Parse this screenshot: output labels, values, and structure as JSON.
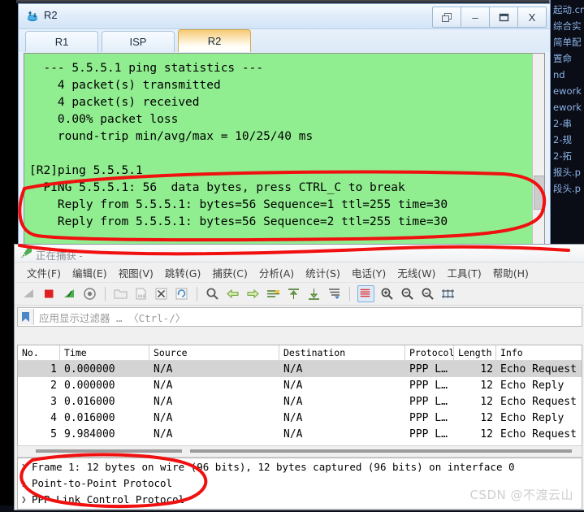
{
  "router_window": {
    "title": "R2",
    "icon": "router-icon",
    "window_buttons": [
      {
        "name": "restore-button",
        "label": "❐"
      },
      {
        "name": "minimize-button",
        "label": "–"
      },
      {
        "name": "maximize-button",
        "label": "▭"
      },
      {
        "name": "close-button",
        "label": "X"
      }
    ],
    "tabs": [
      {
        "label": "R1",
        "active": false
      },
      {
        "label": "ISP",
        "active": false
      },
      {
        "label": "R2",
        "active": true
      }
    ],
    "terminal_bg": "#90ee90",
    "terminal_text": "  --- 5.5.5.1 ping statistics ---\n    4 packet(s) transmitted\n    4 packet(s) received\n    0.00% packet loss\n    round-trip min/avg/max = 10/25/40 ms\n\n[R2]ping 5.5.5.1\n  PING 5.5.5.1: 56  data bytes, press CTRL_C to break\n    Reply from 5.5.5.1: bytes=56 Sequence=1 ttl=255 time=30\n    Reply from 5.5.5.1: bytes=56 Sequence=2 ttl=255 time=30"
  },
  "wireshark": {
    "title": "正在捕获 -",
    "icon": "wireshark-icon",
    "menus": [
      "文件(F)",
      "编辑(E)",
      "视图(V)",
      "跳转(G)",
      "捕获(C)",
      "分析(A)",
      "统计(S)",
      "电话(Y)",
      "无线(W)",
      "工具(T)",
      "帮助(H)"
    ],
    "toolbar_icons": [
      "start-capture-icon",
      "stop-capture-icon",
      "restart-capture-icon",
      "capture-options-icon",
      "open-file-icon",
      "save-file-icon",
      "close-file-icon",
      "reload-file-icon",
      "find-packet-icon",
      "go-back-icon",
      "go-forward-icon",
      "go-to-packet-icon",
      "go-to-first-icon",
      "go-to-last-icon",
      "auto-scroll-icon",
      "colorize-icon",
      "zoom-in-icon",
      "zoom-out-icon",
      "zoom-reset-icon",
      "resize-columns-icon"
    ],
    "filter": {
      "bookmark_icon": "bookmark-icon",
      "placeholder": "应用显示过滤器 … 〈Ctrl-/〉",
      "value": ""
    },
    "packet_list": {
      "columns": [
        "No.",
        "Time",
        "Source",
        "Destination",
        "Protocol",
        "Length",
        "Info"
      ],
      "rows": [
        {
          "no": "1",
          "time": "0.000000",
          "source": "N/A",
          "destination": "N/A",
          "protocol": "PPP L…",
          "length": "12",
          "info": "Echo Request",
          "selected": true
        },
        {
          "no": "2",
          "time": "0.000000",
          "source": "N/A",
          "destination": "N/A",
          "protocol": "PPP L…",
          "length": "12",
          "info": "Echo Reply",
          "selected": false
        },
        {
          "no": "3",
          "time": "0.016000",
          "source": "N/A",
          "destination": "N/A",
          "protocol": "PPP L…",
          "length": "12",
          "info": "Echo Request",
          "selected": false
        },
        {
          "no": "4",
          "time": "0.016000",
          "source": "N/A",
          "destination": "N/A",
          "protocol": "PPP L…",
          "length": "12",
          "info": "Echo Reply",
          "selected": false
        },
        {
          "no": "5",
          "time": "9.984000",
          "source": "N/A",
          "destination": "N/A",
          "protocol": "PPP L…",
          "length": "12",
          "info": "Echo Request",
          "selected": false
        }
      ]
    },
    "packet_detail": {
      "rows": [
        "Frame 1: 12 bytes on wire (96 bits), 12 bytes captured (96 bits) on interface 0",
        "Point-to-Point Protocol",
        "PPP Link Control Protocol"
      ]
    }
  },
  "background_cmd": {
    "lines": [
      "综合实",
      "简单配",
      "置命",
      "nd",
      "",
      "ework",
      "ework",
      "2-串",
      "2-规",
      "2-拓",
      "报头.p",
      "段头.p"
    ],
    "top_label": "起动.cmd"
  },
  "watermark": "CSDN @不渡云山",
  "annotation_color": "#f01010"
}
